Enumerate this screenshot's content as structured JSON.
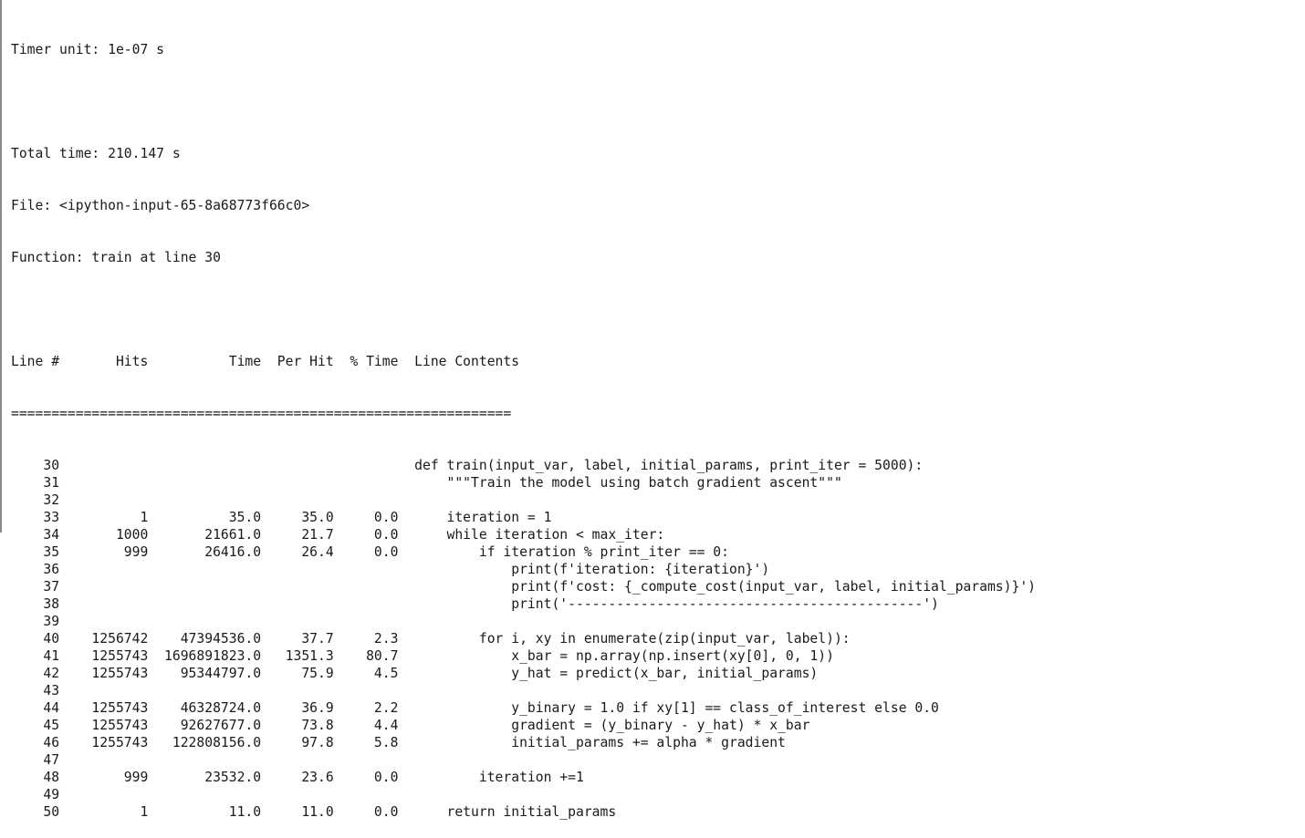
{
  "header": {
    "timer_unit": "Timer unit: 1e-07 s",
    "total_time": "Total time: 210.147 s",
    "file": "File: <ipython-input-65-8a68773f66c0>",
    "function": "Function: train at line 30"
  },
  "table": {
    "columns": [
      "Line #",
      "Hits",
      "Time",
      "Per Hit",
      "% Time",
      "Line Contents"
    ],
    "separator": "==============================================================",
    "rows": [
      {
        "line": "30",
        "hits": "",
        "time": "",
        "per_hit": "",
        "pct": "",
        "code": "def train(input_var, label, initial_params, print_iter = 5000):"
      },
      {
        "line": "31",
        "hits": "",
        "time": "",
        "per_hit": "",
        "pct": "",
        "code": "    \"\"\"Train the model using batch gradient ascent\"\"\""
      },
      {
        "line": "32",
        "hits": "",
        "time": "",
        "per_hit": "",
        "pct": "",
        "code": ""
      },
      {
        "line": "33",
        "hits": "1",
        "time": "35.0",
        "per_hit": "35.0",
        "pct": "0.0",
        "code": "    iteration = 1"
      },
      {
        "line": "34",
        "hits": "1000",
        "time": "21661.0",
        "per_hit": "21.7",
        "pct": "0.0",
        "code": "    while iteration < max_iter:"
      },
      {
        "line": "35",
        "hits": "999",
        "time": "26416.0",
        "per_hit": "26.4",
        "pct": "0.0",
        "code": "        if iteration % print_iter == 0:"
      },
      {
        "line": "36",
        "hits": "",
        "time": "",
        "per_hit": "",
        "pct": "",
        "code": "            print(f'iteration: {iteration}')"
      },
      {
        "line": "37",
        "hits": "",
        "time": "",
        "per_hit": "",
        "pct": "",
        "code": "            print(f'cost: {_compute_cost(input_var, label, initial_params)}')"
      },
      {
        "line": "38",
        "hits": "",
        "time": "",
        "per_hit": "",
        "pct": "",
        "code": "            print('--------------------------------------------')"
      },
      {
        "line": "39",
        "hits": "",
        "time": "",
        "per_hit": "",
        "pct": "",
        "code": ""
      },
      {
        "line": "40",
        "hits": "1256742",
        "time": "47394536.0",
        "per_hit": "37.7",
        "pct": "2.3",
        "code": "        for i, xy in enumerate(zip(input_var, label)):"
      },
      {
        "line": "41",
        "hits": "1255743",
        "time": "1696891823.0",
        "per_hit": "1351.3",
        "pct": "80.7",
        "code": "            x_bar = np.array(np.insert(xy[0], 0, 1))"
      },
      {
        "line": "42",
        "hits": "1255743",
        "time": "95344797.0",
        "per_hit": "75.9",
        "pct": "4.5",
        "code": "            y_hat = predict(x_bar, initial_params)"
      },
      {
        "line": "43",
        "hits": "",
        "time": "",
        "per_hit": "",
        "pct": "",
        "code": ""
      },
      {
        "line": "44",
        "hits": "1255743",
        "time": "46328724.0",
        "per_hit": "36.9",
        "pct": "2.2",
        "code": "            y_binary = 1.0 if xy[1] == class_of_interest else 0.0"
      },
      {
        "line": "45",
        "hits": "1255743",
        "time": "92627677.0",
        "per_hit": "73.8",
        "pct": "4.4",
        "code": "            gradient = (y_binary - y_hat) * x_bar"
      },
      {
        "line": "46",
        "hits": "1255743",
        "time": "122808156.0",
        "per_hit": "97.8",
        "pct": "5.8",
        "code": "            initial_params += alpha * gradient"
      },
      {
        "line": "47",
        "hits": "",
        "time": "",
        "per_hit": "",
        "pct": "",
        "code": ""
      },
      {
        "line": "48",
        "hits": "999",
        "time": "23532.0",
        "per_hit": "23.6",
        "pct": "0.0",
        "code": "        iteration +=1"
      },
      {
        "line": "49",
        "hits": "",
        "time": "",
        "per_hit": "",
        "pct": "",
        "code": ""
      },
      {
        "line": "50",
        "hits": "1",
        "time": "11.0",
        "per_hit": "11.0",
        "pct": "0.0",
        "code": "    return initial_params"
      }
    ]
  }
}
